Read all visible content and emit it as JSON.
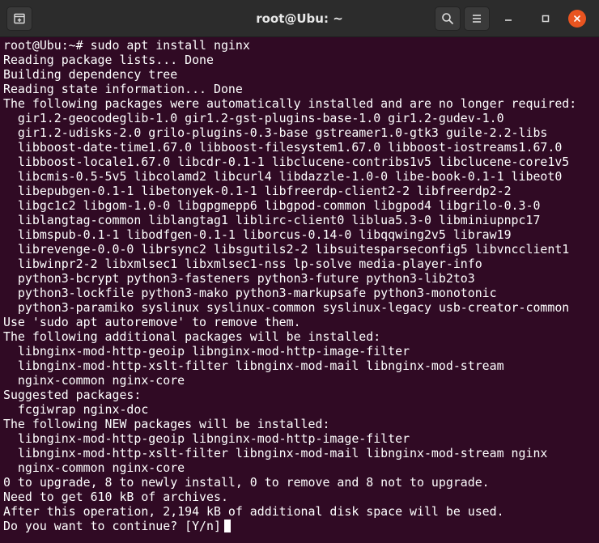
{
  "window": {
    "title": "root@Ubu: ~",
    "icons": {
      "new_tab": "new-tab-icon",
      "search": "search-icon",
      "menu": "hamburger-menu-icon",
      "minimize": "minimize-icon",
      "maximize": "maximize-icon",
      "close": "close-icon"
    },
    "colors": {
      "background": "#300a24",
      "titlebar": "#2c2c2c",
      "close": "#e95420",
      "text": "#ffffff"
    }
  },
  "terminal": {
    "lines": [
      "root@Ubu:~# sudo apt install nginx",
      "Reading package lists... Done",
      "Building dependency tree",
      "Reading state information... Done",
      "The following packages were automatically installed and are no longer required:",
      "  gir1.2-geocodeglib-1.0 gir1.2-gst-plugins-base-1.0 gir1.2-gudev-1.0",
      "  gir1.2-udisks-2.0 grilo-plugins-0.3-base gstreamer1.0-gtk3 guile-2.2-libs",
      "  libboost-date-time1.67.0 libboost-filesystem1.67.0 libboost-iostreams1.67.0",
      "  libboost-locale1.67.0 libcdr-0.1-1 libclucene-contribs1v5 libclucene-core1v5",
      "  libcmis-0.5-5v5 libcolamd2 libcurl4 libdazzle-1.0-0 libe-book-0.1-1 libeot0",
      "  libepubgen-0.1-1 libetonyek-0.1-1 libfreerdp-client2-2 libfreerdp2-2",
      "  libgc1c2 libgom-1.0-0 libgpgmepp6 libgpod-common libgpod4 libgrilo-0.3-0",
      "  liblangtag-common liblangtag1 liblirc-client0 liblua5.3-0 libminiupnpc17",
      "  libmspub-0.1-1 libodfgen-0.1-1 liborcus-0.14-0 libqqwing2v5 libraw19",
      "  librevenge-0.0-0 librsync2 libsgutils2-2 libsuitesparseconfig5 libvncclient1",
      "  libwinpr2-2 libxmlsec1 libxmlsec1-nss lp-solve media-player-info",
      "  python3-bcrypt python3-fasteners python3-future python3-lib2to3",
      "  python3-lockfile python3-mako python3-markupsafe python3-monotonic",
      "  python3-paramiko syslinux syslinux-common syslinux-legacy usb-creator-common",
      "Use 'sudo apt autoremove' to remove them.",
      "The following additional packages will be installed:",
      "  libnginx-mod-http-geoip libnginx-mod-http-image-filter",
      "  libnginx-mod-http-xslt-filter libnginx-mod-mail libnginx-mod-stream",
      "  nginx-common nginx-core",
      "Suggested packages:",
      "  fcgiwrap nginx-doc",
      "The following NEW packages will be installed:",
      "  libnginx-mod-http-geoip libnginx-mod-http-image-filter",
      "  libnginx-mod-http-xslt-filter libnginx-mod-mail libnginx-mod-stream nginx",
      "  nginx-common nginx-core",
      "0 to upgrade, 8 to newly install, 0 to remove and 8 not to upgrade.",
      "Need to get 610 kB of archives.",
      "After this operation, 2,194 kB of additional disk space will be used."
    ],
    "prompt": "Do you want to continue? [Y/n]"
  }
}
